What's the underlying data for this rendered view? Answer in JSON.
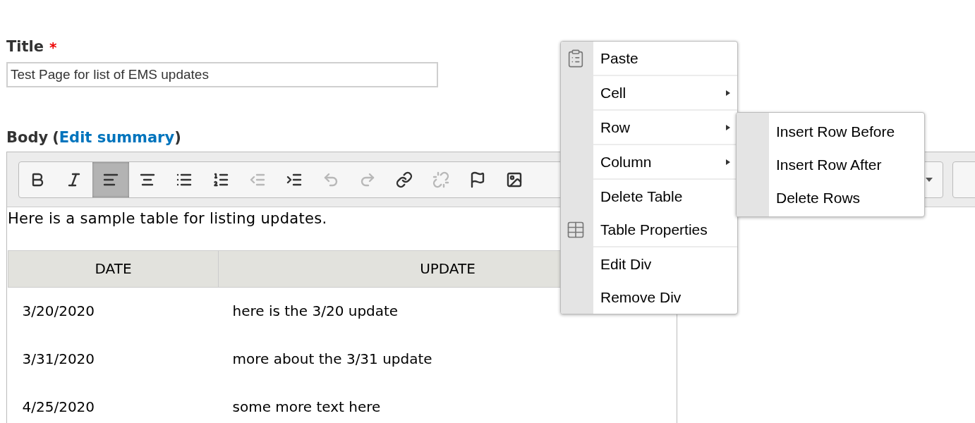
{
  "title_field": {
    "label": "Title",
    "required_mark": "*",
    "value": "Test Page for list of EMS updates"
  },
  "body_field": {
    "label": "Body",
    "open_paren": "(",
    "link": "Edit summary",
    "close_paren": ")"
  },
  "toolbar": [
    {
      "kind": "bold",
      "selected": false,
      "disabled": false
    },
    {
      "kind": "italic",
      "selected": false,
      "disabled": false
    },
    {
      "kind": "align-left",
      "selected": true,
      "disabled": false
    },
    {
      "kind": "align-center",
      "selected": false,
      "disabled": false
    },
    {
      "kind": "bullet-list",
      "selected": false,
      "disabled": false
    },
    {
      "kind": "numbered-list",
      "selected": false,
      "disabled": false
    },
    {
      "kind": "outdent",
      "selected": false,
      "disabled": true
    },
    {
      "kind": "indent",
      "selected": false,
      "disabled": false
    },
    {
      "kind": "undo",
      "selected": false,
      "disabled": true
    },
    {
      "kind": "redo",
      "selected": false,
      "disabled": true
    },
    {
      "kind": "link",
      "selected": false,
      "disabled": false
    },
    {
      "kind": "unlink",
      "selected": false,
      "disabled": true
    },
    {
      "kind": "anchor",
      "selected": false,
      "disabled": false
    },
    {
      "kind": "image",
      "selected": false,
      "disabled": false
    }
  ],
  "content": {
    "paragraph": "Here is a sample table for listing updates.",
    "table": {
      "columns": [
        "DATE",
        "UPDATE"
      ],
      "rows": [
        [
          "3/20/2020",
          "here is the 3/20 update"
        ],
        [
          "3/31/2020",
          "more about the 3/31 update"
        ],
        [
          "4/25/2020",
          "some more text here"
        ]
      ]
    }
  },
  "context_menu": {
    "groups": [
      [
        {
          "label": "Paste",
          "kind": "clipboard",
          "submenu": false
        }
      ],
      [
        {
          "label": "Cell",
          "submenu": true
        }
      ],
      [
        {
          "label": "Row",
          "submenu": true,
          "open_submenu": [
            "Insert Row Before",
            "Insert Row After",
            "Delete Rows"
          ]
        }
      ],
      [
        {
          "label": "Column",
          "submenu": true
        }
      ],
      [
        {
          "label": "Delete Table",
          "submenu": false
        },
        {
          "label": "Table Properties",
          "kind": "table",
          "submenu": false
        }
      ],
      [
        {
          "label": "Edit Div",
          "submenu": false
        },
        {
          "label": "Remove Div",
          "submenu": false
        }
      ]
    ]
  }
}
